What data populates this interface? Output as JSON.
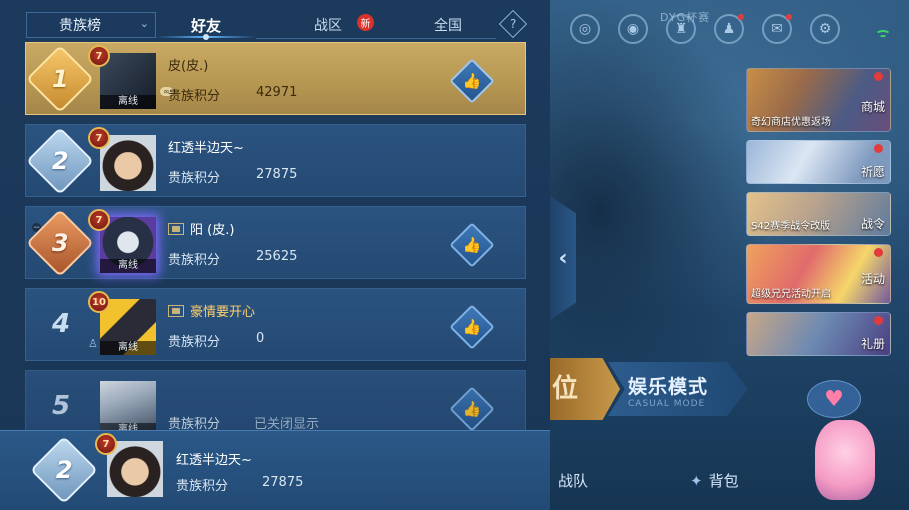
{
  "background": {
    "top_text": "DYG杯赛",
    "mode_left": "位",
    "mode_right": "娱乐模式",
    "mode_right_en": "CASUAL MODE",
    "bottom_items": [
      {
        "label": "战队",
        "icon": "team-icon"
      },
      {
        "label": "背包",
        "icon": "backpack-icon"
      }
    ],
    "side_cards": [
      {
        "caption": "奇幻商店优惠返场",
        "label": "商城"
      },
      {
        "caption": "",
        "label": "祈愿"
      },
      {
        "caption": "S42赛季战令改版",
        "label": "战令"
      },
      {
        "caption": "超级兄兄活动开启",
        "label": "活动"
      },
      {
        "caption": "",
        "label": "礼册"
      }
    ]
  },
  "tabs": {
    "dropdown": "贵族榜",
    "items": [
      {
        "label": "好友",
        "active": true
      },
      {
        "label": "战区",
        "badge": "新"
      },
      {
        "label": "全国"
      }
    ],
    "help": "?"
  },
  "score_label": "贵族积分",
  "offline_label": "离线",
  "rows": [
    {
      "rank": "1",
      "level": "7",
      "name": "皮(皮.)",
      "score": "42971",
      "offline": true
    },
    {
      "rank": "2",
      "level": "7",
      "name": "红透半边天~",
      "score": "27875",
      "offline": false
    },
    {
      "rank": "3",
      "level": "7",
      "name": "阳 (皮.)",
      "score": "25625",
      "offline": true
    },
    {
      "rank": "4",
      "level": "10",
      "name": "豪情要开心",
      "score": "0",
      "offline": true
    },
    {
      "rank": "5",
      "level": "",
      "name": "",
      "score": "已关闭显示",
      "offline": true
    }
  ],
  "self": {
    "rank": "2",
    "level": "7",
    "name": "红透半边天~",
    "score": "27875"
  }
}
